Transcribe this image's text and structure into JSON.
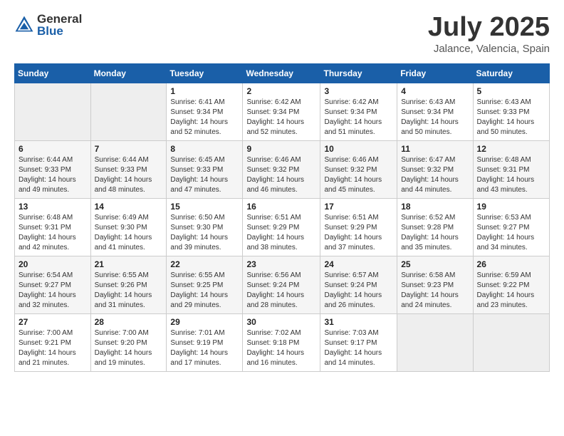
{
  "logo": {
    "general": "General",
    "blue": "Blue"
  },
  "title": "July 2025",
  "location": "Jalance, Valencia, Spain",
  "days_of_week": [
    "Sunday",
    "Monday",
    "Tuesday",
    "Wednesday",
    "Thursday",
    "Friday",
    "Saturday"
  ],
  "weeks": [
    [
      {
        "day": "",
        "info": ""
      },
      {
        "day": "",
        "info": ""
      },
      {
        "day": "1",
        "info": "Sunrise: 6:41 AM\nSunset: 9:34 PM\nDaylight: 14 hours and 52 minutes."
      },
      {
        "day": "2",
        "info": "Sunrise: 6:42 AM\nSunset: 9:34 PM\nDaylight: 14 hours and 52 minutes."
      },
      {
        "day": "3",
        "info": "Sunrise: 6:42 AM\nSunset: 9:34 PM\nDaylight: 14 hours and 51 minutes."
      },
      {
        "day": "4",
        "info": "Sunrise: 6:43 AM\nSunset: 9:34 PM\nDaylight: 14 hours and 50 minutes."
      },
      {
        "day": "5",
        "info": "Sunrise: 6:43 AM\nSunset: 9:33 PM\nDaylight: 14 hours and 50 minutes."
      }
    ],
    [
      {
        "day": "6",
        "info": "Sunrise: 6:44 AM\nSunset: 9:33 PM\nDaylight: 14 hours and 49 minutes."
      },
      {
        "day": "7",
        "info": "Sunrise: 6:44 AM\nSunset: 9:33 PM\nDaylight: 14 hours and 48 minutes."
      },
      {
        "day": "8",
        "info": "Sunrise: 6:45 AM\nSunset: 9:33 PM\nDaylight: 14 hours and 47 minutes."
      },
      {
        "day": "9",
        "info": "Sunrise: 6:46 AM\nSunset: 9:32 PM\nDaylight: 14 hours and 46 minutes."
      },
      {
        "day": "10",
        "info": "Sunrise: 6:46 AM\nSunset: 9:32 PM\nDaylight: 14 hours and 45 minutes."
      },
      {
        "day": "11",
        "info": "Sunrise: 6:47 AM\nSunset: 9:32 PM\nDaylight: 14 hours and 44 minutes."
      },
      {
        "day": "12",
        "info": "Sunrise: 6:48 AM\nSunset: 9:31 PM\nDaylight: 14 hours and 43 minutes."
      }
    ],
    [
      {
        "day": "13",
        "info": "Sunrise: 6:48 AM\nSunset: 9:31 PM\nDaylight: 14 hours and 42 minutes."
      },
      {
        "day": "14",
        "info": "Sunrise: 6:49 AM\nSunset: 9:30 PM\nDaylight: 14 hours and 41 minutes."
      },
      {
        "day": "15",
        "info": "Sunrise: 6:50 AM\nSunset: 9:30 PM\nDaylight: 14 hours and 39 minutes."
      },
      {
        "day": "16",
        "info": "Sunrise: 6:51 AM\nSunset: 9:29 PM\nDaylight: 14 hours and 38 minutes."
      },
      {
        "day": "17",
        "info": "Sunrise: 6:51 AM\nSunset: 9:29 PM\nDaylight: 14 hours and 37 minutes."
      },
      {
        "day": "18",
        "info": "Sunrise: 6:52 AM\nSunset: 9:28 PM\nDaylight: 14 hours and 35 minutes."
      },
      {
        "day": "19",
        "info": "Sunrise: 6:53 AM\nSunset: 9:27 PM\nDaylight: 14 hours and 34 minutes."
      }
    ],
    [
      {
        "day": "20",
        "info": "Sunrise: 6:54 AM\nSunset: 9:27 PM\nDaylight: 14 hours and 32 minutes."
      },
      {
        "day": "21",
        "info": "Sunrise: 6:55 AM\nSunset: 9:26 PM\nDaylight: 14 hours and 31 minutes."
      },
      {
        "day": "22",
        "info": "Sunrise: 6:55 AM\nSunset: 9:25 PM\nDaylight: 14 hours and 29 minutes."
      },
      {
        "day": "23",
        "info": "Sunrise: 6:56 AM\nSunset: 9:24 PM\nDaylight: 14 hours and 28 minutes."
      },
      {
        "day": "24",
        "info": "Sunrise: 6:57 AM\nSunset: 9:24 PM\nDaylight: 14 hours and 26 minutes."
      },
      {
        "day": "25",
        "info": "Sunrise: 6:58 AM\nSunset: 9:23 PM\nDaylight: 14 hours and 24 minutes."
      },
      {
        "day": "26",
        "info": "Sunrise: 6:59 AM\nSunset: 9:22 PM\nDaylight: 14 hours and 23 minutes."
      }
    ],
    [
      {
        "day": "27",
        "info": "Sunrise: 7:00 AM\nSunset: 9:21 PM\nDaylight: 14 hours and 21 minutes."
      },
      {
        "day": "28",
        "info": "Sunrise: 7:00 AM\nSunset: 9:20 PM\nDaylight: 14 hours and 19 minutes."
      },
      {
        "day": "29",
        "info": "Sunrise: 7:01 AM\nSunset: 9:19 PM\nDaylight: 14 hours and 17 minutes."
      },
      {
        "day": "30",
        "info": "Sunrise: 7:02 AM\nSunset: 9:18 PM\nDaylight: 14 hours and 16 minutes."
      },
      {
        "day": "31",
        "info": "Sunrise: 7:03 AM\nSunset: 9:17 PM\nDaylight: 14 hours and 14 minutes."
      },
      {
        "day": "",
        "info": ""
      },
      {
        "day": "",
        "info": ""
      }
    ]
  ]
}
